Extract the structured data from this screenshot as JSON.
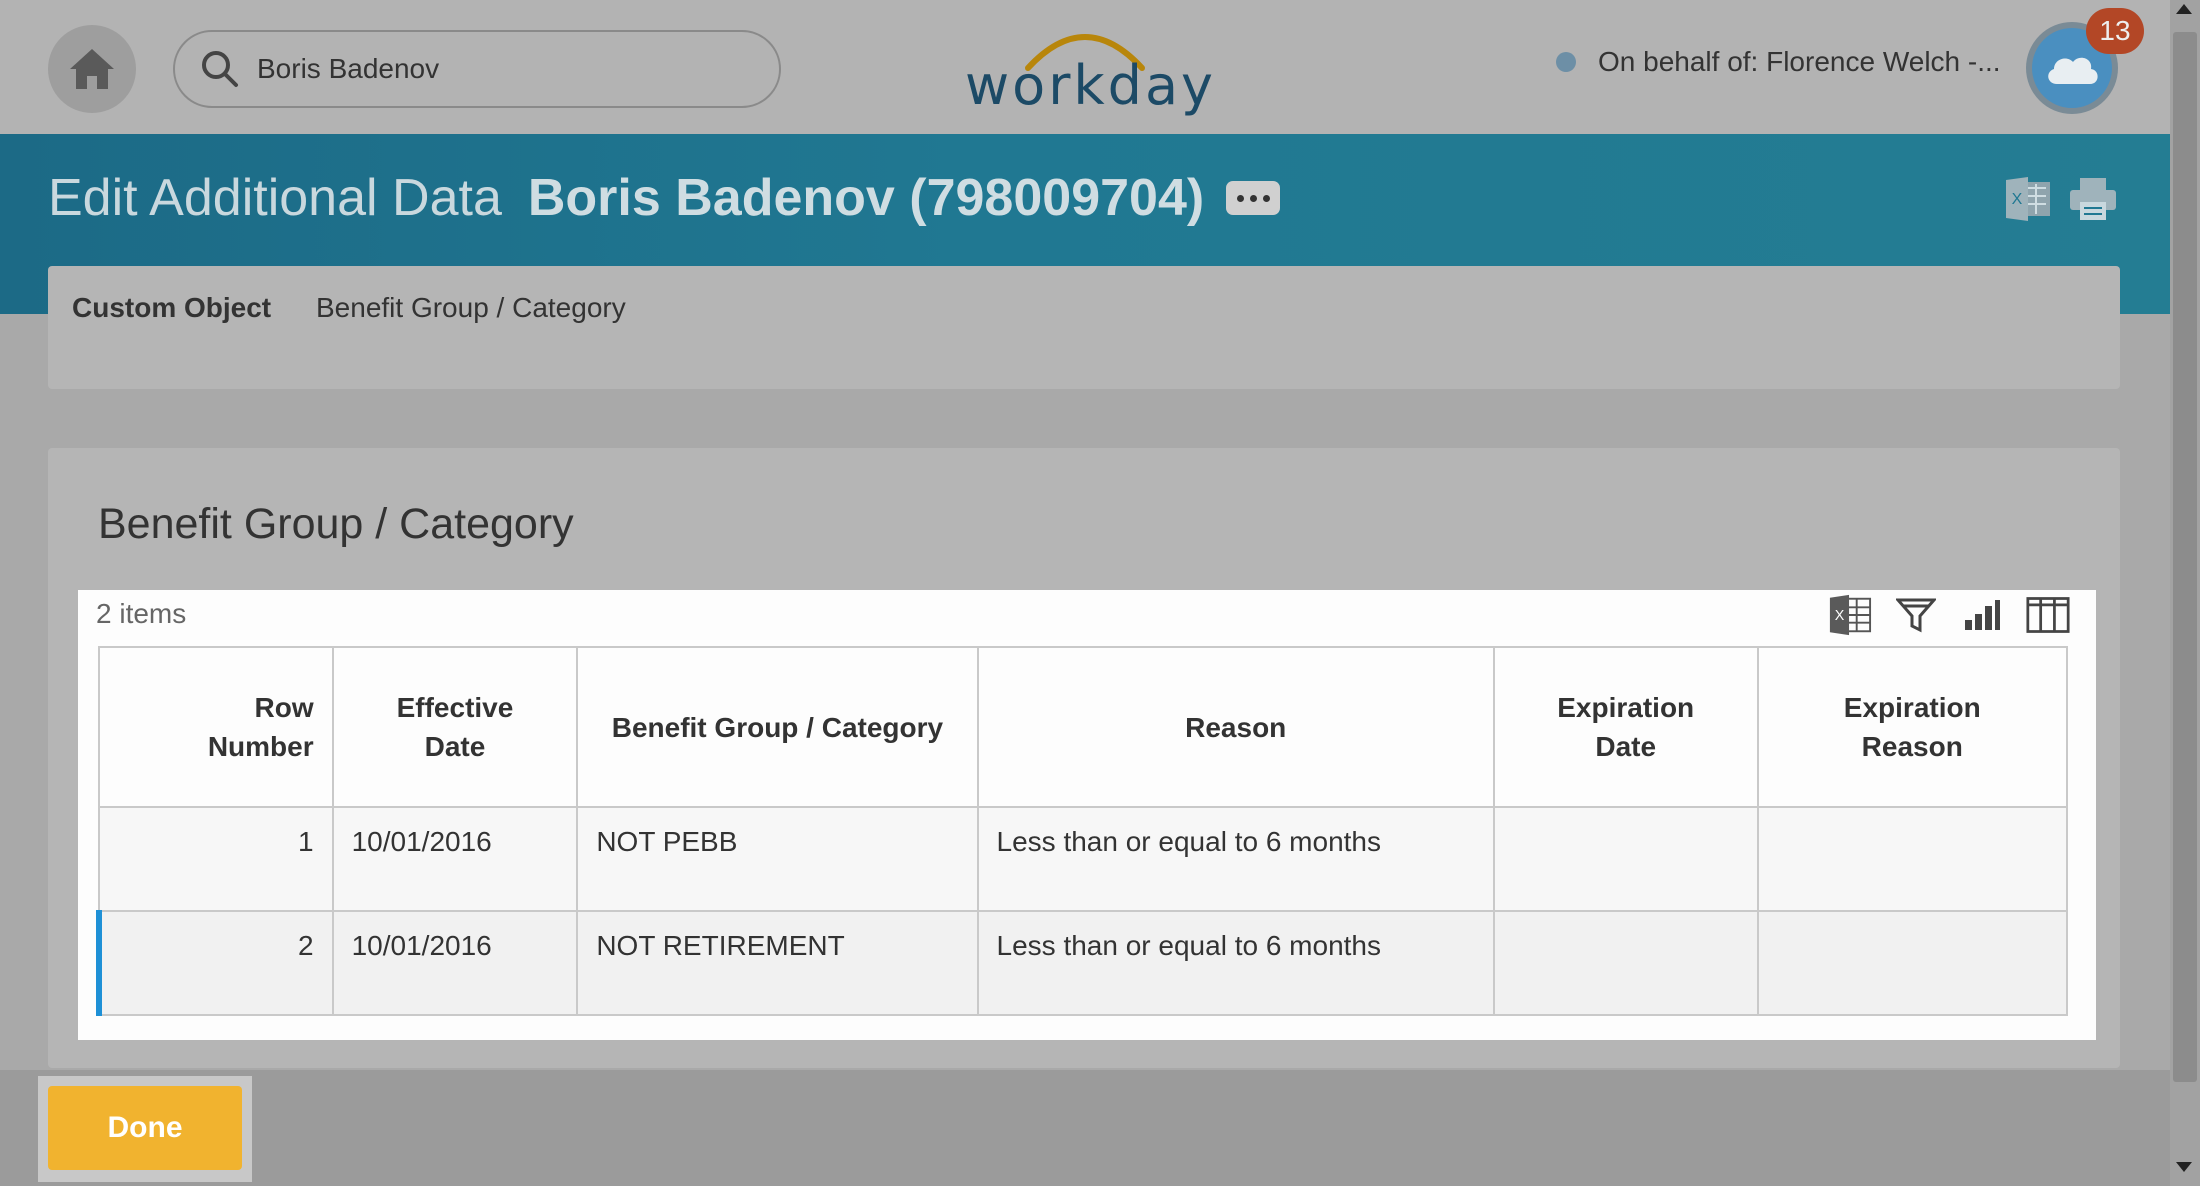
{
  "header": {
    "search_value": "Boris Badenov",
    "logo_text": "workday",
    "on_behalf": "On behalf of: Florence Welch -...",
    "notification_count": "13"
  },
  "title": {
    "main": "Edit Additional Data",
    "subject": "Boris Badenov (798009704)"
  },
  "custom_object": {
    "label": "Custom Object",
    "value": "Benefit Group / Category"
  },
  "section": {
    "title": "Benefit Group / Category",
    "items_count": "2 items"
  },
  "table": {
    "headers": {
      "row_number": [
        "Row",
        "Number"
      ],
      "effective_date": [
        "Effective",
        "Date"
      ],
      "benefit_group": "Benefit Group / Category",
      "reason": "Reason",
      "expiration_date": [
        "Expiration",
        "Date"
      ],
      "expiration_reason": [
        "Expiration",
        "Reason"
      ]
    },
    "rows": [
      {
        "row_number": "1",
        "effective_date": "10/01/2016",
        "benefit_group": "NOT PEBB",
        "reason": "Less than or equal to 6 months",
        "expiration_date": "",
        "expiration_reason": ""
      },
      {
        "row_number": "2",
        "effective_date": "10/01/2016",
        "benefit_group": "NOT RETIREMENT",
        "reason": "Less than or equal to 6 months",
        "expiration_date": "",
        "expiration_reason": ""
      }
    ]
  },
  "footer": {
    "done_label": "Done"
  },
  "colors": {
    "accent_band": "#207892",
    "done_button": "#f1b32f",
    "badge": "#b34726",
    "row_indicator": "#1e90d6"
  }
}
